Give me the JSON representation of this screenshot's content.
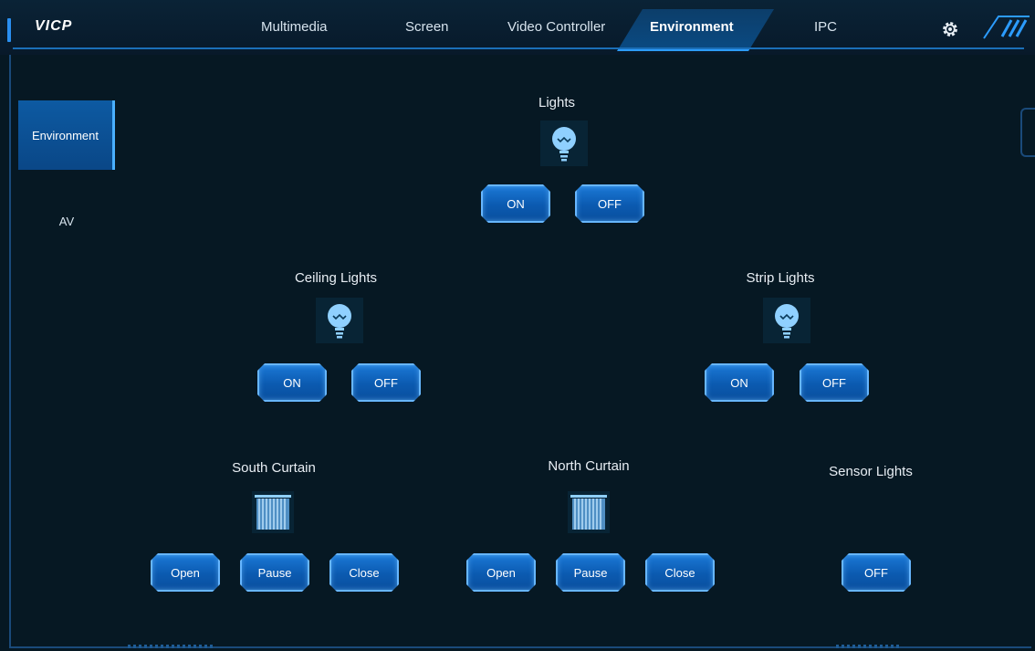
{
  "app": {
    "logo": "VICP"
  },
  "nav": {
    "items": [
      {
        "label": "Multimedia"
      },
      {
        "label": "Screen"
      },
      {
        "label": "Video Controller"
      },
      {
        "label": "Environment"
      },
      {
        "label": "IPC"
      }
    ],
    "active": "Environment"
  },
  "sidebar": {
    "items": [
      {
        "label": "Environment",
        "active": true
      },
      {
        "label": "AV",
        "active": false
      }
    ]
  },
  "groups": {
    "lights": {
      "title": "Lights",
      "on": "ON",
      "off": "OFF"
    },
    "ceiling": {
      "title": "Ceiling Lights",
      "on": "ON",
      "off": "OFF"
    },
    "strip": {
      "title": "Strip Lights",
      "on": "ON",
      "off": "OFF"
    },
    "south": {
      "title": "South Curtain",
      "open": "Open",
      "pause": "Pause",
      "close": "Close"
    },
    "north": {
      "title": "North Curtain",
      "open": "Open",
      "pause": "Pause",
      "close": "Close"
    },
    "sensor": {
      "title": "Sensor Lights",
      "off": "OFF"
    }
  },
  "colors": {
    "background": "#061823",
    "accent": "#2c9cff",
    "button": "#0b5ab0",
    "icon": "#8fd0ff"
  }
}
